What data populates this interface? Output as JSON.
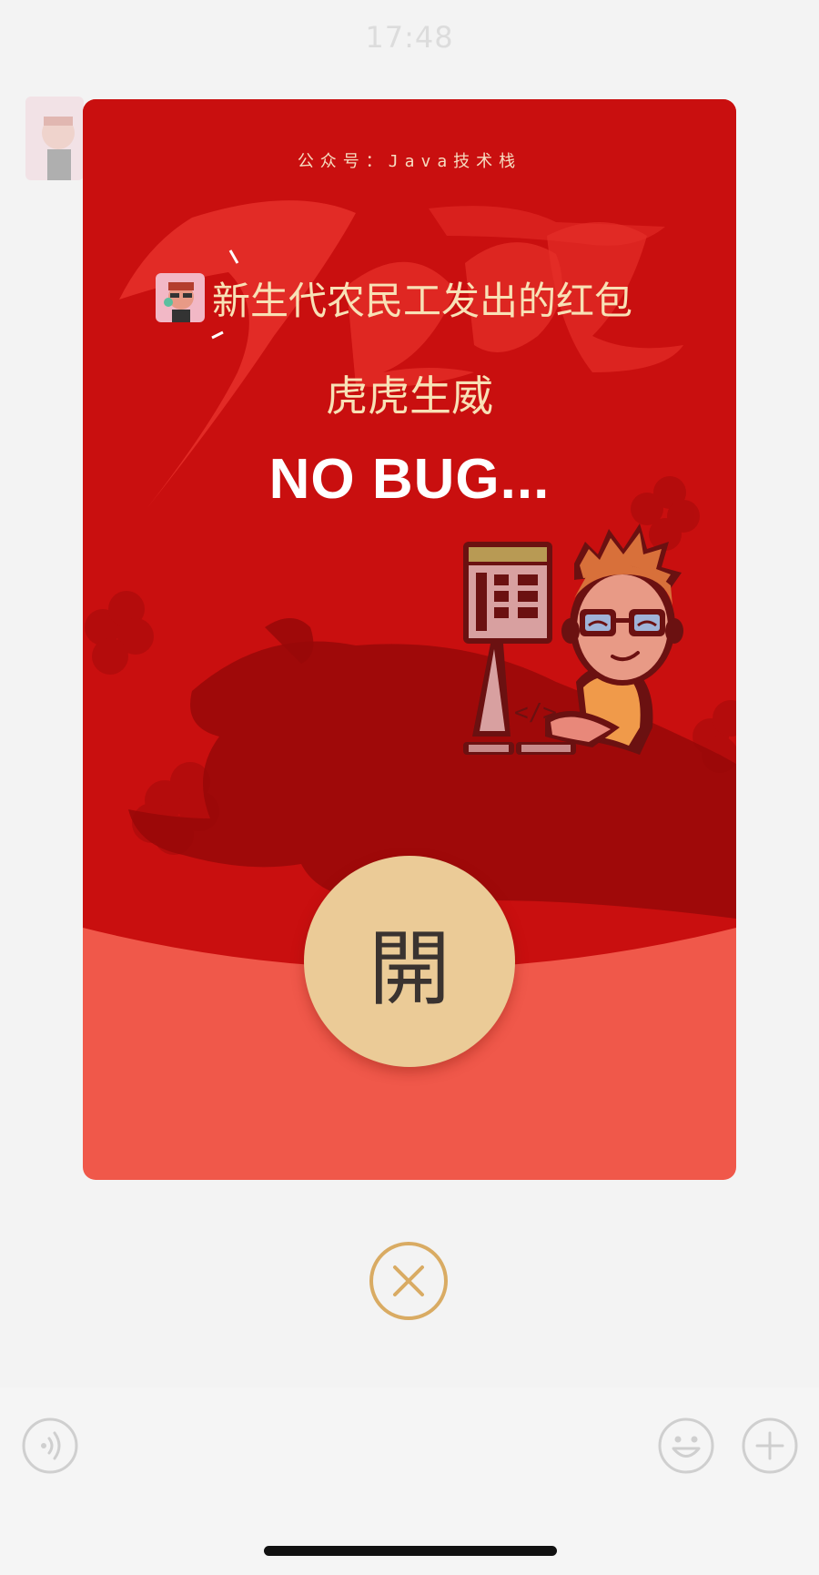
{
  "status_bar": {
    "time": "17:48"
  },
  "red_packet": {
    "account_label": "公众号：Java技术栈",
    "sender_title": "新生代农民工发出的红包",
    "blessing": "虎虎生威",
    "slogan": "NO BUG...",
    "open_button_label": "開"
  },
  "icons": {
    "close": "close-circle-icon",
    "voice": "voice-icon",
    "emoji": "emoji-smile-icon",
    "plus": "plus-circle-icon"
  },
  "colors": {
    "card_red": "#c90f0f",
    "card_lower": "#f0584a",
    "gold_text": "#f8e1b6",
    "open_button": "#ebcb97",
    "close_ring": "#d9ab63"
  }
}
